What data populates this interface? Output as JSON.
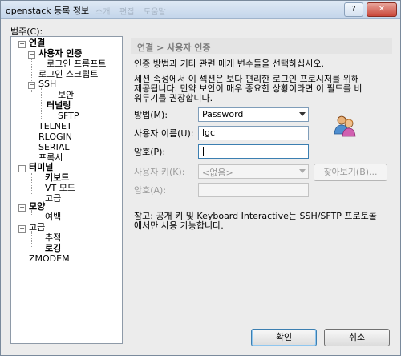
{
  "window": {
    "title": "openstack 등록 정보",
    "ghost_tabs": [
      "소개",
      "편집",
      "도움말"
    ],
    "help_button": "?",
    "close_button": "✕"
  },
  "category_label": "범주(C):",
  "tree": {
    "connection": "연결",
    "auth": "사용자 인증",
    "login_prompt": "로그인 프롬프트",
    "login_script": "로그인 스크립트",
    "ssh": "SSH",
    "security": "보안",
    "tunneling": "터널링",
    "sftp": "SFTP",
    "telnet": "TELNET",
    "rlogin": "RLOGIN",
    "serial": "SERIAL",
    "proxy": "프록시",
    "terminal": "터미널",
    "keyboard": "키보드",
    "vt_mode": "VT 모드",
    "advanced_term": "고급",
    "appearance": "모양",
    "margin": "여백",
    "advanced": "고급",
    "trace": "추적",
    "log": "로깅",
    "zmodem": "ZMODEM"
  },
  "panel": {
    "header": "연결 > 사용자 인증",
    "intro": "인증 방법과 기타 관련 매개 변수들을 선택하십시오.",
    "description_line1": "세션 속성에서 이 섹션은 보다 편리한 로그인 프로시저를 위해",
    "description_line2": "제공됩니다. 만약 보안이 매우 중요한 상황이라면 이 필드를 비",
    "description_line3": "워두기를 권장합니다.",
    "method_label": "방법(M):",
    "method_value": "Password",
    "username_label": "사용자 이름(U):",
    "username_value": "lgc",
    "password_label": "암호(P):",
    "password_value": "",
    "userkey_label": "사용자 키(K):",
    "userkey_value": "<없음>",
    "browse_button": "찾아보기(B)...",
    "passphrase_label": "암호(A):",
    "note_line1": "참고: 공개 키 및 Keyboard Interactive는 SSH/SFTP 프로토콜",
    "note_line2": "에서만 사용 가능합니다."
  },
  "buttons": {
    "ok": "확인",
    "cancel": "취소"
  }
}
